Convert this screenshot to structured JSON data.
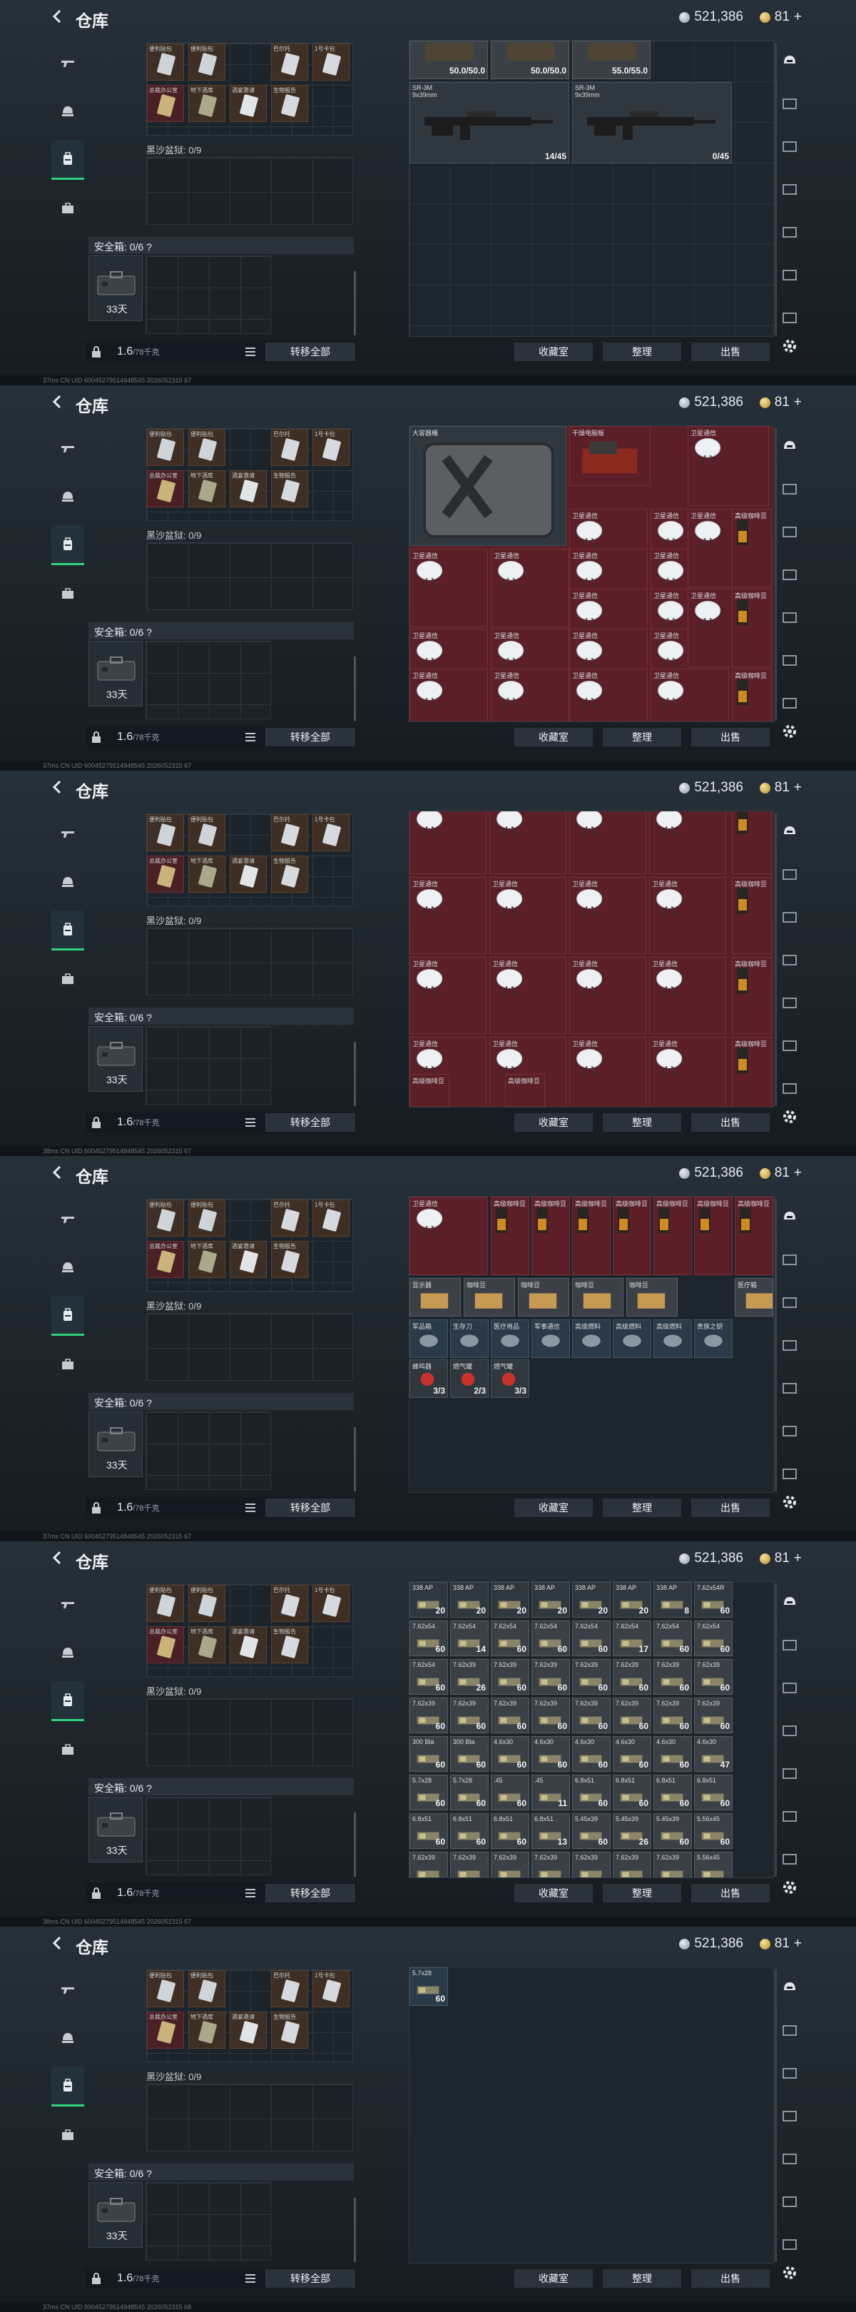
{
  "header": {
    "title": "仓库",
    "money": "521,386",
    "gold": "81",
    "gold_plus": "+"
  },
  "gear": {
    "slot_labels": [
      "便利贴包",
      "便利贴包",
      "巴尔托",
      "1号卡包",
      "总裁办公室",
      "地下酒库",
      "酒宴邀请",
      "生物报告"
    ],
    "mm_label": "黑沙盆狱: 0/9",
    "safe_label": "安全箱: 0/6 ?",
    "safe_days": "33天",
    "weight_value": "1.6",
    "weight_unit": "/78千克",
    "transfer_all": "转移全部"
  },
  "stash_buttons": {
    "storage": "收藏室",
    "sort": "整理",
    "sell": "出售"
  },
  "status_text": [
    "37ms   CN UID 60045279514848545 2026052315 67",
    "37ms   CN UID 60045279514848545 2026052315 67",
    "38ms   CN UID 60045279514848545 2026052315 67",
    "37ms   CN UID 60045279514848545 2026052315 67",
    "38ms   CN UID 60045279514848545 2026052315 67",
    "37ms   CN UID 60045279514848545 2026052315 68"
  ],
  "screen1": {
    "armor": [
      "50.0/50.0",
      "50.0/50.0",
      "55.0/55.0"
    ],
    "guns": [
      {
        "name": "SR-3M",
        "caliber": "9x39mm",
        "ammo": "14/45"
      },
      {
        "name": "SR-3M",
        "caliber": "9x39mm",
        "ammo": "0/45"
      }
    ]
  },
  "screen2": {
    "big_item": "大容器桶",
    "device_item": "干燥电脑板",
    "dish_label": "卫星通信",
    "coffee_label": "高级咖啡豆"
  },
  "screen3": {
    "dish_label": "卫星通信",
    "bottom_label": "高级咖啡豆"
  },
  "screen4": {
    "top_labels": [
      "卫星通信",
      "高级咖啡豆",
      "高级咖啡豆",
      "高级咖啡豆",
      "高级咖啡豆",
      "高级咖啡豆",
      "高级咖啡豆",
      "高级咖啡豆"
    ],
    "row2_labels": [
      "显示器",
      "咖啡豆",
      "咖啡豆",
      "咖啡豆",
      "咖啡豆",
      "医疗箱"
    ],
    "row3_labels": [
      "军品箱",
      "生存刀",
      "医疗用品",
      "军事通信",
      "高级燃料",
      "高级燃料",
      "高级燃料",
      "贵族之钥"
    ],
    "counts": [
      "3/3",
      "2/3",
      "3/3"
    ],
    "row4_labels": [
      "蜂鸣器",
      "燃气罐",
      "燃气罐"
    ]
  },
  "screen5": {
    "rows": [
      {
        "labels": [
          "338 AP",
          "338 AP",
          "338 AP",
          "338 AP",
          "338 AP",
          "338 AP",
          "338 AP",
          "7.62x54R"
        ],
        "counts": [
          "20",
          "20",
          "20",
          "20",
          "20",
          "20",
          "8",
          "60"
        ]
      },
      {
        "labels": [
          "7.62x54",
          "7.62x54",
          "7.62x54",
          "7.62x54",
          "7.62x54",
          "7.62x54",
          "7.62x54",
          "7.62x54"
        ],
        "counts": [
          "60",
          "14",
          "60",
          "60",
          "60",
          "17",
          "60",
          "60"
        ]
      },
      {
        "labels": [
          "7.62x54",
          "7.62x39",
          "7.62x39",
          "7.62x39",
          "7.62x39",
          "7.62x39",
          "7.62x39",
          "7.62x39"
        ],
        "counts": [
          "60",
          "26",
          "60",
          "60",
          "60",
          "60",
          "60",
          "60"
        ]
      },
      {
        "labels": [
          "7.62x39",
          "7.62x39",
          "7.62x39",
          "7.62x39",
          "7.62x39",
          "7.62x39",
          "7.62x39",
          "7.62x39"
        ],
        "counts": [
          "60",
          "60",
          "60",
          "60",
          "60",
          "60",
          "60",
          "60"
        ]
      },
      {
        "labels": [
          "300 Bla",
          "300 Bla",
          "4.6x30",
          "4.6x30",
          "4.6x30",
          "4.6x30",
          "4.6x30",
          "4.6x30"
        ],
        "counts": [
          "60",
          "60",
          "60",
          "60",
          "60",
          "60",
          "60",
          "47"
        ]
      },
      {
        "labels": [
          "5.7x28",
          "5.7x28",
          ".45",
          ".45",
          "6.8x51",
          "6.8x51",
          "6.8x51",
          "6.8x51"
        ],
        "counts": [
          "60",
          "60",
          "60",
          "11",
          "60",
          "60",
          "60",
          "60"
        ]
      },
      {
        "labels": [
          "6.8x51",
          "6.8x51",
          "6.8x51",
          "6.8x51",
          "5.45x39",
          "5.45x39",
          "5.45x39",
          "5.56x45"
        ],
        "counts": [
          "60",
          "60",
          "60",
          "13",
          "60",
          "26",
          "60",
          "60"
        ]
      },
      {
        "labels": [
          "7.62x39",
          "7.62x39",
          "7.62x39",
          "7.62x39",
          "7.62x39",
          "7.62x39",
          "7.62x39",
          "5.56x45"
        ],
        "counts": [
          "",
          "",
          "",
          "",
          "",
          "",
          "",
          ""
        ]
      }
    ]
  },
  "screen6": {
    "item": {
      "label": "5.7x28",
      "count": "60"
    }
  },
  "colors": {
    "accent_green": "#2fd27a",
    "item_red": "#5c1f27"
  }
}
